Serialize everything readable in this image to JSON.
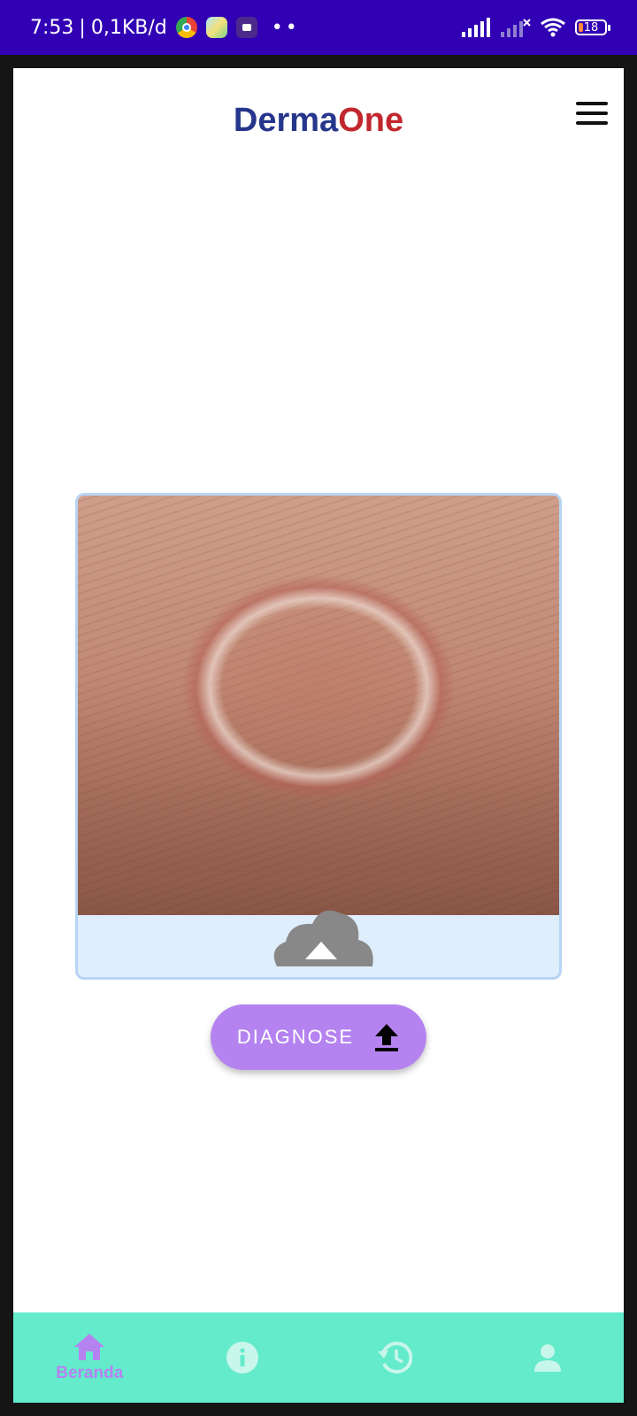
{
  "status_bar": {
    "time": "7:53",
    "separator": "|",
    "network_speed": "0,1KB/d",
    "dots": "••",
    "battery_level": "18"
  },
  "header": {
    "brand_part1": "Derma",
    "brand_part2": "One",
    "brand_colors": {
      "derma": "#26368c",
      "one": "#c1272d"
    },
    "menu_icon": "hamburger-menu-icon"
  },
  "upload": {
    "image_subject": "skin-lesion-photo",
    "upload_icon": "cloud-upload-icon"
  },
  "actions": {
    "diagnose_label": "DIAGNOSE",
    "diagnose_icon": "upload-arrow-icon",
    "button_color": "#b583f0"
  },
  "bottom_nav": {
    "background": "#63ebcb",
    "active_color": "#b583f0",
    "items": [
      {
        "label": "Beranda",
        "icon": "home-icon",
        "active": true
      },
      {
        "label": "",
        "icon": "info-icon",
        "active": false
      },
      {
        "label": "",
        "icon": "history-icon",
        "active": false
      },
      {
        "label": "",
        "icon": "profile-icon",
        "active": false
      }
    ]
  }
}
